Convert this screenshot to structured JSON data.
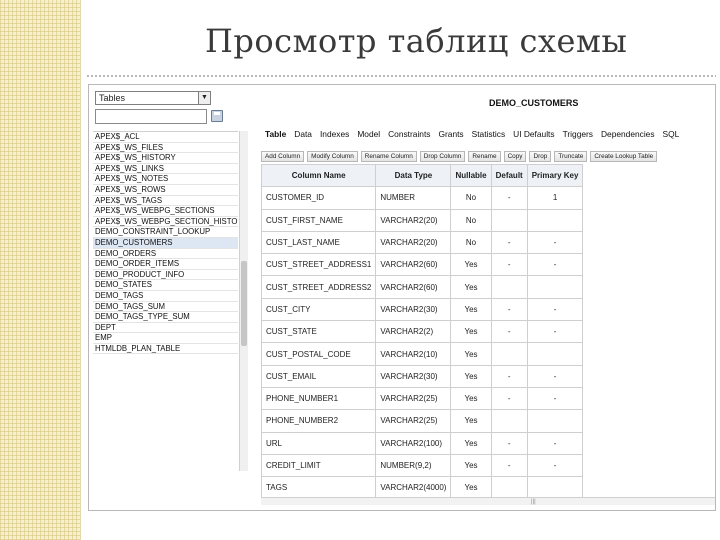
{
  "slide": {
    "title": "Просмотр таблиц схемы"
  },
  "browser": {
    "object_type": "Tables",
    "search_value": "",
    "objects": [
      "APEX$_ACL",
      "APEX$_WS_FILES",
      "APEX$_WS_HISTORY",
      "APEX$_WS_LINKS",
      "APEX$_WS_NOTES",
      "APEX$_WS_ROWS",
      "APEX$_WS_TAGS",
      "APEX$_WS_WEBPG_SECTIONS",
      "APEX$_WS_WEBPG_SECTION_HISTO",
      "DEMO_CONSTRAINT_LOOKUP",
      "DEMO_CUSTOMERS",
      "DEMO_ORDERS",
      "DEMO_ORDER_ITEMS",
      "DEMO_PRODUCT_INFO",
      "DEMO_STATES",
      "DEMO_TAGS",
      "DEMO_TAGS_SUM",
      "DEMO_TAGS_TYPE_SUM",
      "DEPT",
      "EMP",
      "HTMLDB_PLAN_TABLE"
    ],
    "selected_index": 10
  },
  "detail": {
    "object_name": "DEMO_CUSTOMERS",
    "tabs": [
      "Table",
      "Data",
      "Indexes",
      "Model",
      "Constraints",
      "Grants",
      "Statistics",
      "UI Defaults",
      "Triggers",
      "Dependencies",
      "SQL"
    ],
    "active_tab": 0,
    "tools": [
      "Add Column",
      "Modify Column",
      "Rename Column",
      "Drop Column",
      "Rename",
      "Copy",
      "Drop",
      "Truncate",
      "Create Lookup Table"
    ],
    "columns_header": [
      "Column Name",
      "Data Type",
      "Nullable",
      "Default",
      "Primary Key"
    ],
    "rows": [
      [
        "CUSTOMER_ID",
        "NUMBER",
        "No",
        "-",
        "1"
      ],
      [
        "CUST_FIRST_NAME",
        "VARCHAR2(20)",
        "No",
        "",
        ""
      ],
      [
        "CUST_LAST_NAME",
        "VARCHAR2(20)",
        "No",
        "-",
        "-"
      ],
      [
        "CUST_STREET_ADDRESS1",
        "VARCHAR2(60)",
        "Yes",
        "-",
        "-"
      ],
      [
        "CUST_STREET_ADDRESS2",
        "VARCHAR2(60)",
        "Yes",
        "",
        ""
      ],
      [
        "CUST_CITY",
        "VARCHAR2(30)",
        "Yes",
        "-",
        "-"
      ],
      [
        "CUST_STATE",
        "VARCHAR2(2)",
        "Yes",
        "-",
        "-"
      ],
      [
        "CUST_POSTAL_CODE",
        "VARCHAR2(10)",
        "Yes",
        "",
        ""
      ],
      [
        "CUST_EMAIL",
        "VARCHAR2(30)",
        "Yes",
        "-",
        "-"
      ],
      [
        "PHONE_NUMBER1",
        "VARCHAR2(25)",
        "Yes",
        "-",
        "-"
      ],
      [
        "PHONE_NUMBER2",
        "VARCHAR2(25)",
        "Yes",
        "",
        ""
      ],
      [
        "URL",
        "VARCHAR2(100)",
        "Yes",
        "-",
        "-"
      ],
      [
        "CREDIT_LIMIT",
        "NUMBER(9,2)",
        "Yes",
        "-",
        "-"
      ],
      [
        "TAGS",
        "VARCHAR2(4000)",
        "Yes",
        "",
        ""
      ]
    ]
  }
}
